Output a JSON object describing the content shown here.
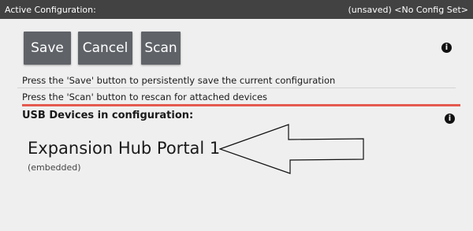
{
  "title_bar": {
    "title": "Active Configuration:",
    "status": "(unsaved) <No Config Set>"
  },
  "toolbar": {
    "save_label": "Save",
    "cancel_label": "Cancel",
    "scan_label": "Scan",
    "info_icon": "info-icon"
  },
  "help": {
    "save_hint": "Press the 'Save' button to persistently save the current configuration",
    "scan_hint": "Press the 'Scan' button to rescan for attached devices"
  },
  "usb_section": {
    "heading": "USB Devices in configuration:",
    "info_icon": "info-icon",
    "devices": [
      {
        "name": "Expansion Hub Portal 1",
        "detail": "(embedded)"
      }
    ]
  },
  "colors": {
    "title_bar_bg": "#424242",
    "button_bg": "#5f6368",
    "accent_divider": "#e55a4f",
    "page_bg": "#efefef"
  },
  "annotation": {
    "arrow_icon": "arrow-left-outline-icon"
  }
}
